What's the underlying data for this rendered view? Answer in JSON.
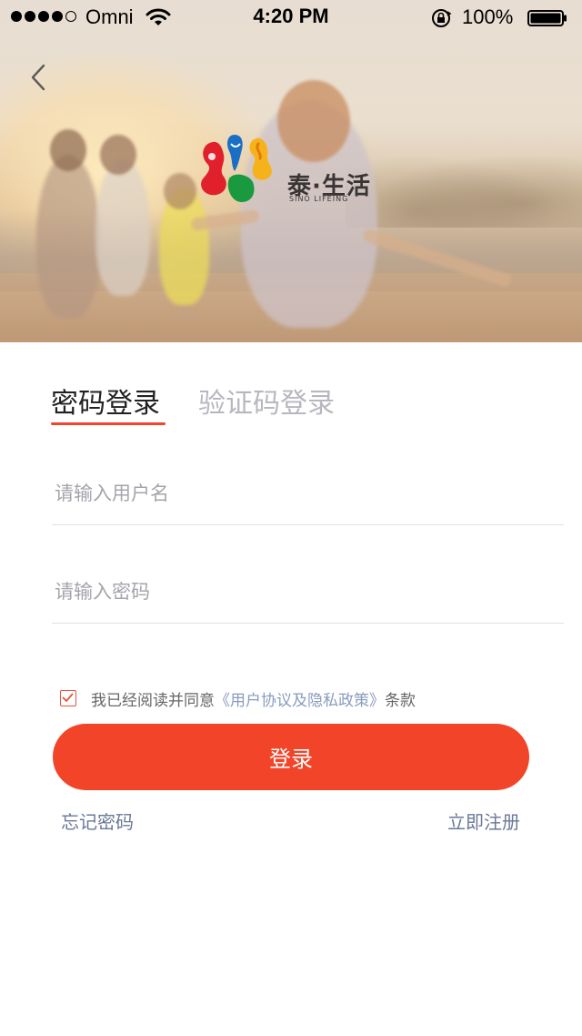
{
  "status_bar": {
    "carrier": "Omni",
    "time": "4:20 PM",
    "battery": "100%",
    "signal_bars_filled": 4,
    "signal_bars_total": 5
  },
  "header": {
    "back_icon": "chevron-left-icon"
  },
  "logo": {
    "brand_cn": "泰·生活",
    "brand_en": "SINO LIFEING"
  },
  "tabs": [
    {
      "label": "密码登录",
      "active": true
    },
    {
      "label": "验证码登录",
      "active": false
    }
  ],
  "form": {
    "username_placeholder": "请输入用户名",
    "password_placeholder": "请输入密码",
    "username_value": "",
    "password_value": ""
  },
  "agreement": {
    "checked": true,
    "prefix": "我已经阅读并同意",
    "link": "《用户协议及隐私政策》",
    "suffix": "条款"
  },
  "actions": {
    "login": "登录",
    "forgot_password": "忘记密码",
    "register": "立即注册"
  },
  "colors": {
    "accent": "#f24428",
    "link": "#8a9bbd",
    "secondary_link": "#6b7896",
    "inactive_tab": "#b7b7bf"
  }
}
